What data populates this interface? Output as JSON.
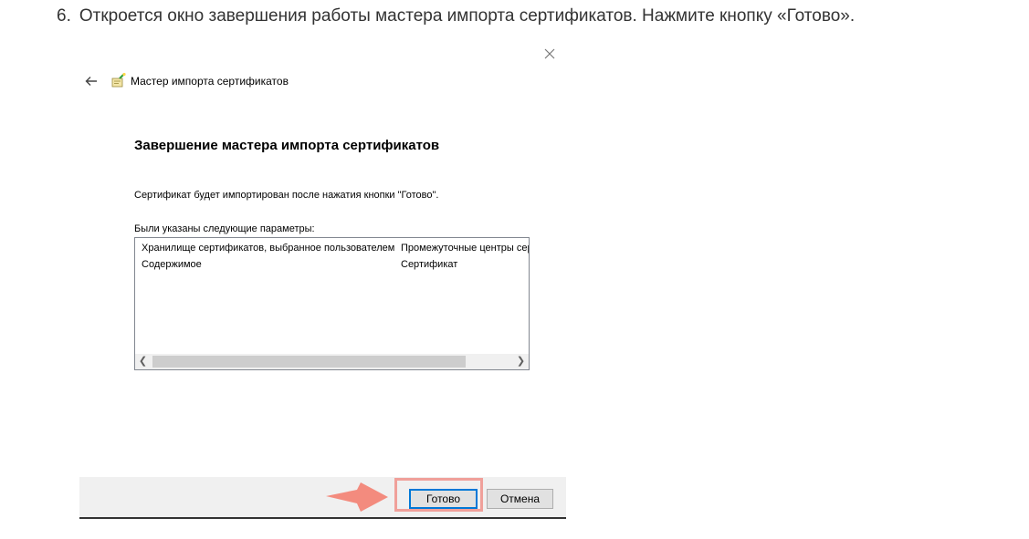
{
  "instruction": {
    "number": "6.",
    "text": "Откроется окно завершения работы мастера импорта сертификатов. Нажмите кнопку «Готово»."
  },
  "dialog": {
    "title": "Мастер импорта сертификатов",
    "heading": "Завершение мастера импорта сертификатов",
    "description": "Сертификат будет импортирован после нажатия кнопки \"Готово\".",
    "params_label": "Были указаны следующие параметры:",
    "params": [
      {
        "name": "Хранилище сертификатов, выбранное пользователем",
        "value": "Промежуточные центры сертификации"
      },
      {
        "name": "Содержимое",
        "value": "Сертификат"
      }
    ],
    "buttons": {
      "finish": "Готово",
      "cancel": "Отмена"
    }
  },
  "colors": {
    "accent": "#0078d7",
    "highlight": "#f0a09a"
  },
  "icons": {
    "back": "back-arrow-icon",
    "close": "close-icon",
    "wizard": "certificate-wizard-icon"
  }
}
